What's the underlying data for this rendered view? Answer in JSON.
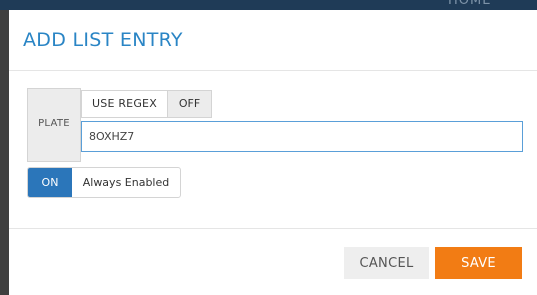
{
  "background": {
    "top_text": "HOME"
  },
  "modal": {
    "title": "ADD LIST ENTRY",
    "plate": {
      "label": "PLATE",
      "regex_label": "USE REGEX",
      "regex_toggle": "OFF",
      "input_value": "8OXHZ7"
    },
    "enabled": {
      "toggle": "ON",
      "label": "Always Enabled"
    },
    "footer": {
      "cancel_label": "CANCEL",
      "save_label": "SAVE"
    }
  },
  "colors": {
    "title": "#2a85c5",
    "on_toggle": "#2b76ba",
    "save_button": "#f27c14",
    "input_border": "#5a9fd8"
  }
}
